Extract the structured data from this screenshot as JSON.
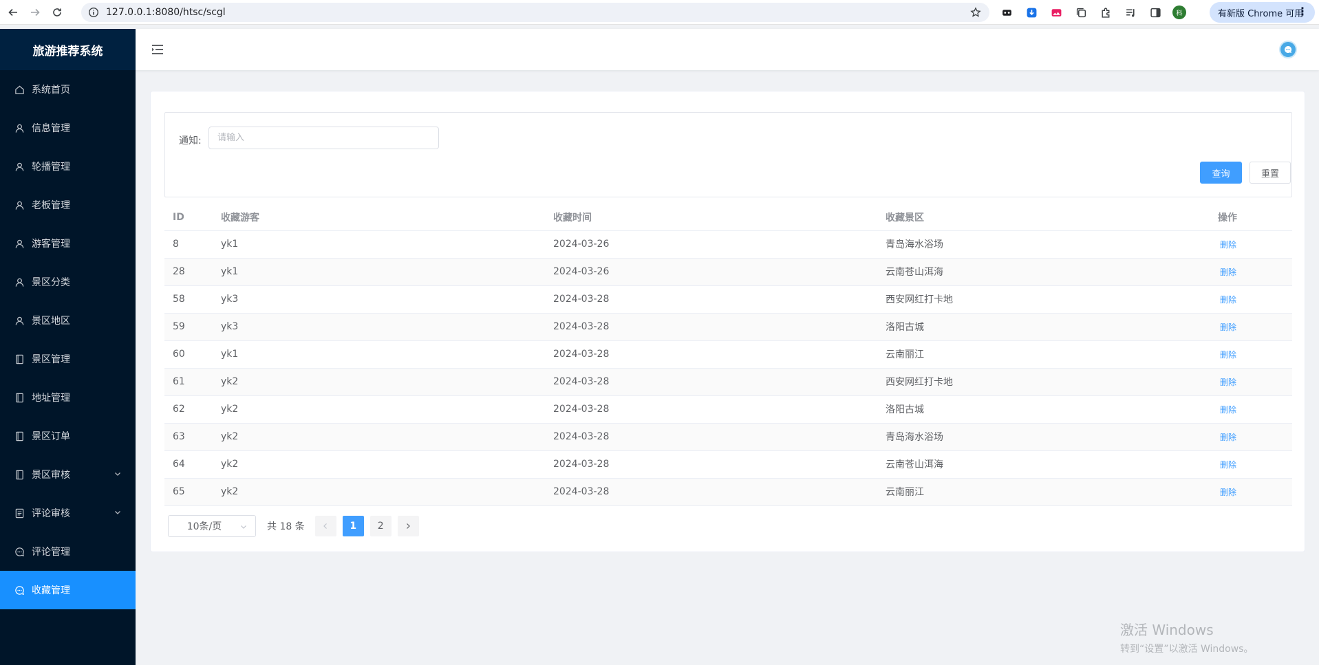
{
  "browser": {
    "url": "127.0.0.1:8080/htsc/scgl",
    "update_label": "有新版 Chrome 可用",
    "profile_initial": "科"
  },
  "sidebar": {
    "title": "旅游推荐系统",
    "items": [
      {
        "label": "系统首页",
        "icon": "home-icon"
      },
      {
        "label": "信息管理",
        "icon": "user-icon"
      },
      {
        "label": "轮播管理",
        "icon": "user-icon"
      },
      {
        "label": "老板管理",
        "icon": "user-icon"
      },
      {
        "label": "游客管理",
        "icon": "user-icon"
      },
      {
        "label": "景区分类",
        "icon": "user-icon"
      },
      {
        "label": "景区地区",
        "icon": "user-icon"
      },
      {
        "label": "景区管理",
        "icon": "tablet-icon"
      },
      {
        "label": "地址管理",
        "icon": "tablet-icon"
      },
      {
        "label": "景区订单",
        "icon": "tablet-icon"
      },
      {
        "label": "景区审核",
        "icon": "tablet-icon"
      },
      {
        "label": "评论审核",
        "icon": "document-icon"
      },
      {
        "label": "评论管理",
        "icon": "chat-icon"
      },
      {
        "label": "收藏管理",
        "icon": "chat-icon"
      }
    ],
    "active_color": "#1890ff"
  },
  "filter": {
    "label": "通知:",
    "placeholder": "请输入",
    "value": "",
    "search_label": "查询",
    "reset_label": "重置"
  },
  "table": {
    "headers": [
      "ID",
      "收藏游客",
      "收藏时间",
      "收藏景区",
      "操作"
    ],
    "rows": [
      {
        "id": "8",
        "user": "yk1",
        "time": "2024-03-26",
        "spot": "青岛海水浴场",
        "action": "删除"
      },
      {
        "id": "28",
        "user": "yk1",
        "time": "2024-03-26",
        "spot": "云南苍山洱海",
        "action": "删除"
      },
      {
        "id": "58",
        "user": "yk3",
        "time": "2024-03-28",
        "spot": "西安网红打卡地",
        "action": "删除"
      },
      {
        "id": "59",
        "user": "yk3",
        "time": "2024-03-28",
        "spot": "洛阳古城",
        "action": "删除"
      },
      {
        "id": "60",
        "user": "yk1",
        "time": "2024-03-28",
        "spot": "云南丽江",
        "action": "删除"
      },
      {
        "id": "61",
        "user": "yk2",
        "time": "2024-03-28",
        "spot": "西安网红打卡地",
        "action": "删除"
      },
      {
        "id": "62",
        "user": "yk2",
        "time": "2024-03-28",
        "spot": "洛阳古城",
        "action": "删除"
      },
      {
        "id": "63",
        "user": "yk2",
        "time": "2024-03-28",
        "spot": "青岛海水浴场",
        "action": "删除"
      },
      {
        "id": "64",
        "user": "yk2",
        "time": "2024-03-28",
        "spot": "云南苍山洱海",
        "action": "删除"
      },
      {
        "id": "65",
        "user": "yk2",
        "time": "2024-03-28",
        "spot": "云南丽江",
        "action": "删除"
      }
    ]
  },
  "pagination": {
    "page_size": "10条/页",
    "total": "共 18 条",
    "pages": [
      "1",
      "2"
    ],
    "current": "1"
  },
  "watermark": {
    "line1": "激活 Windows",
    "line2": "转到“设置”以激活 Windows。"
  }
}
